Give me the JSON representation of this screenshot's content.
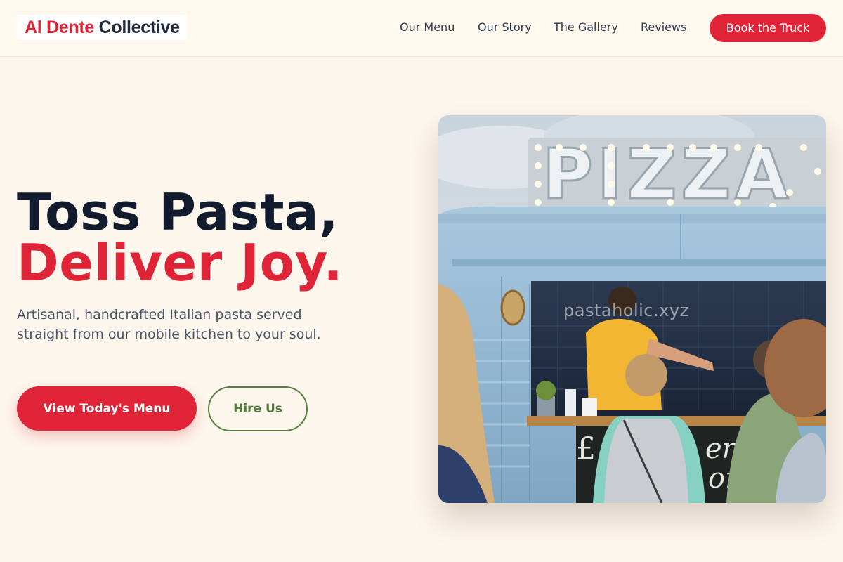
{
  "header": {
    "logo": {
      "brand": "Al Dente",
      "rest": " Collective"
    },
    "nav": [
      {
        "label": "Our Menu"
      },
      {
        "label": "Our Story"
      },
      {
        "label": "The Gallery"
      },
      {
        "label": "Reviews"
      }
    ],
    "cta_label": "Book the Truck"
  },
  "hero": {
    "headline_line1": "Toss Pasta,",
    "headline_line2": "Deliver Joy.",
    "subtext": "Artisanal, handcrafted Italian pasta served straight from our mobile kitchen to your soul.",
    "primary_button": "View Today's Menu",
    "secondary_button": "Hire Us",
    "image": {
      "description_icon": "food-truck-photo",
      "sign_text": "PIZZA",
      "watermark": "pastaholic.xyz",
      "chalkboard_text": "£ erit\n  onl"
    }
  },
  "colors": {
    "accent": "#e02437",
    "dark": "#121a2e",
    "green": "#5a7f44",
    "background": "#fdf6ec"
  }
}
